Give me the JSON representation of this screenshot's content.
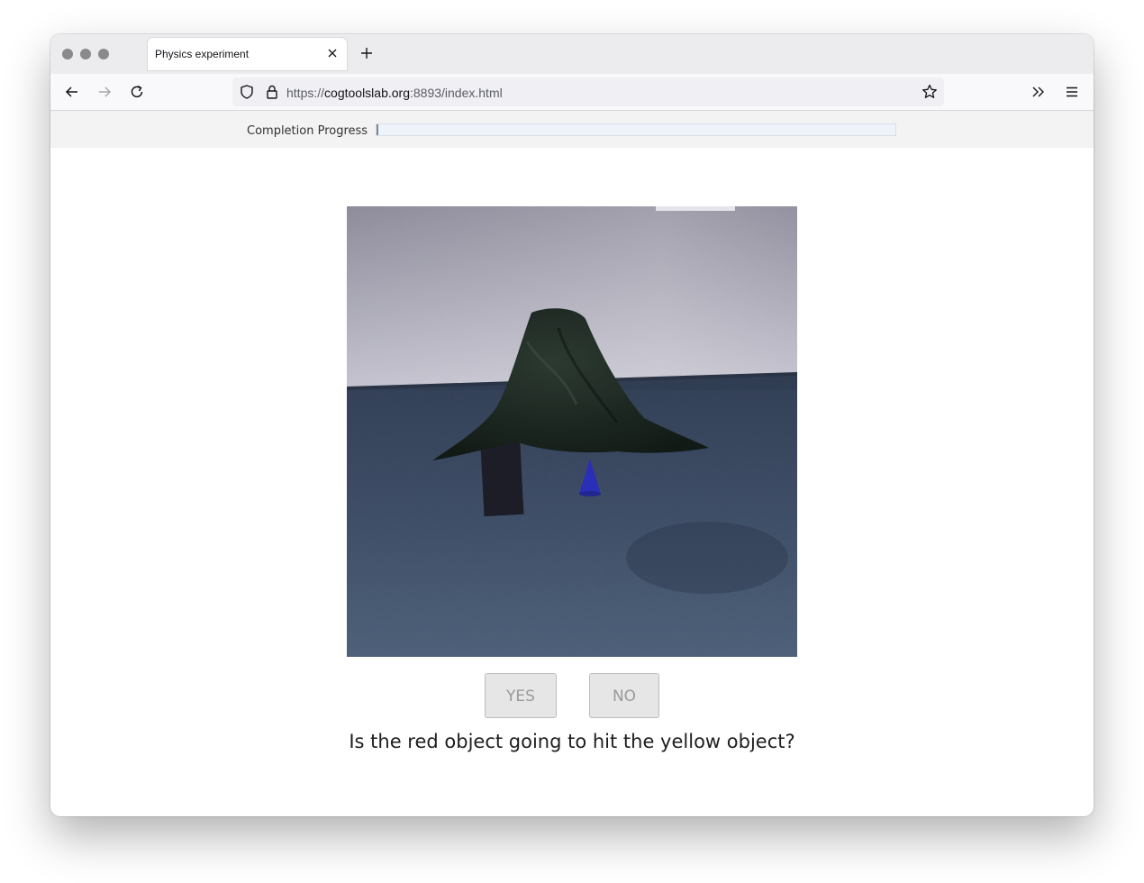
{
  "browser": {
    "tab_title": "Physics experiment",
    "url_prefix": "https://",
    "url_host": "cogtoolslab.org",
    "url_rest": ":8893/index.html"
  },
  "progress": {
    "label": "Completion Progress",
    "value": 0.0
  },
  "stimulus": {
    "icon": "physics-scene-image"
  },
  "buttons": {
    "yes": "YES",
    "no": "NO"
  },
  "question": "Is the red object going to hit the yellow object?"
}
